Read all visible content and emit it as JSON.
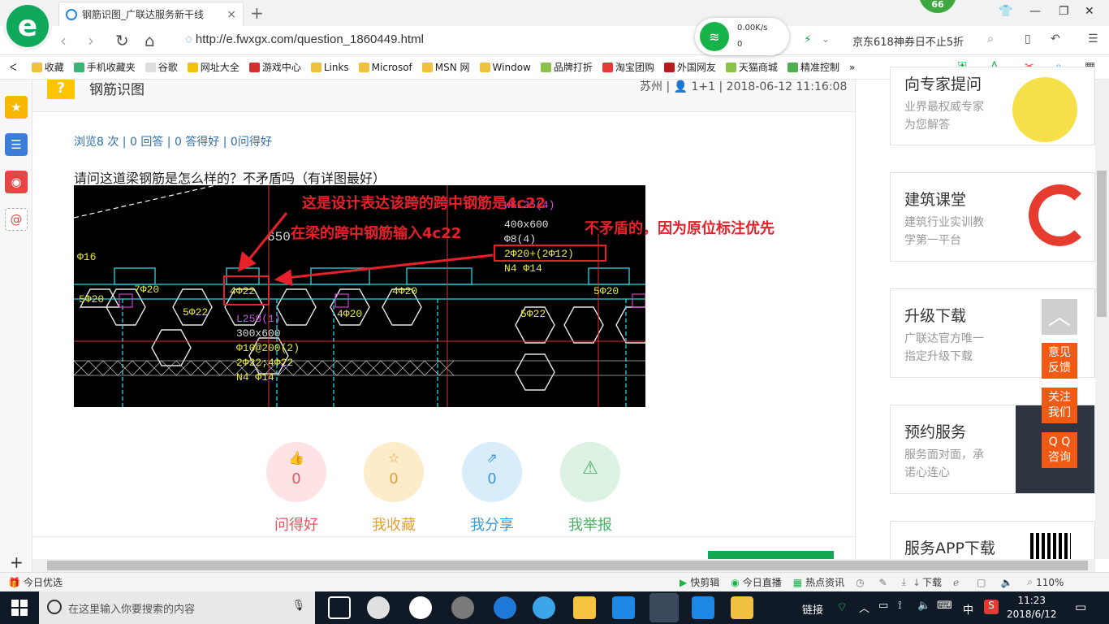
{
  "browser": {
    "logo_letter": "e",
    "tab_title": "钢筋识图_广联达服务新干线",
    "tab_close": "×",
    "new_tab": "+",
    "badge": "66",
    "url": "http://e.fwxgx.com/question_1860449.html",
    "net_speed": "0.00K/s",
    "net_count": "0",
    "promo_text": "京东618神券日不止5折",
    "bookmarks": [
      "收藏",
      "手机收藏夹",
      "谷歌",
      "网址大全",
      "游戏中心",
      "Links",
      "Microsof",
      "MSN 网",
      "Window",
      "品牌打折",
      "淘宝团购",
      "外国网友",
      "天猫商城",
      "精准控制"
    ],
    "more": "»"
  },
  "question": {
    "title": "钢筋识图",
    "meta": "苏州 | 👤 1+1 | 2018-06-12 11:16:08",
    "stats": "浏览8 次 | 0 回答 | 0 答得好 | 0问得好",
    "text": "请问这道梁钢筋是怎么样的？不矛盾吗（有详图最好）"
  },
  "image": {
    "ann1": "这是设计表达该跨的跨中钢筋是4c22",
    "ann2": "在梁的跨中钢筋输入4c22",
    "ann3": "不矛盾的，因为原位标注优先",
    "cad_labels": [
      "7Φ20",
      "4Φ22",
      "4Φ20",
      "5Φ20",
      "5Φ22",
      "5Φ22",
      "4Φ20",
      "5Φ20",
      "WKL25(4)",
      "400x600",
      "Φ8(4)",
      "2Φ20+(2Φ12)",
      "N4 Φ14",
      "L258(1)",
      "300x600",
      "Φ10@200(2)",
      "2Φ22;4Φ22",
      "N4 Φ14",
      "Φ16",
      "650"
    ]
  },
  "actions": [
    {
      "count": "0",
      "label": "问得好",
      "color": "#e8545f",
      "bg": "#fde3e4"
    },
    {
      "count": "0",
      "label": "我收藏",
      "color": "#e0a03a",
      "bg": "#fcecc9"
    },
    {
      "count": "0",
      "label": "我分享",
      "color": "#3a98d6",
      "bg": "#d8ecfa"
    },
    {
      "count": "0",
      "label": "我举报",
      "color": "#46b064",
      "bg": "#dcf2e2"
    }
  ],
  "sidebar_cards": [
    {
      "title": "向专家提问",
      "desc1": "业界最权威专家",
      "desc2": "为您解答"
    },
    {
      "title": "建筑课堂",
      "desc1": "建筑行业实训教",
      "desc2": "学第一平台"
    },
    {
      "title": "升级下载",
      "desc1": "广联达官方唯一",
      "desc2": "指定升级下载"
    },
    {
      "title": "预约服务",
      "desc1": "服务面对面，承",
      "desc2": "诺心连心"
    },
    {
      "title": "服务APP下载",
      "desc1": "",
      "desc2": ""
    }
  ],
  "float_buttons": {
    "feedback1": "意见",
    "feedback2": "反馈",
    "follow1": "关注",
    "follow2": "我们",
    "qq1": "Q Q",
    "qq2": "咨询"
  },
  "statusbar": {
    "left": "今日优选",
    "items": [
      "快剪辑",
      "今日直播",
      "热点资讯",
      "下载",
      "110%"
    ]
  },
  "taskbar": {
    "search_placeholder": "在这里输入你要搜索的内容",
    "tray_links": "链接",
    "ime": "中",
    "time": "11:23",
    "date": "2018/6/12"
  }
}
